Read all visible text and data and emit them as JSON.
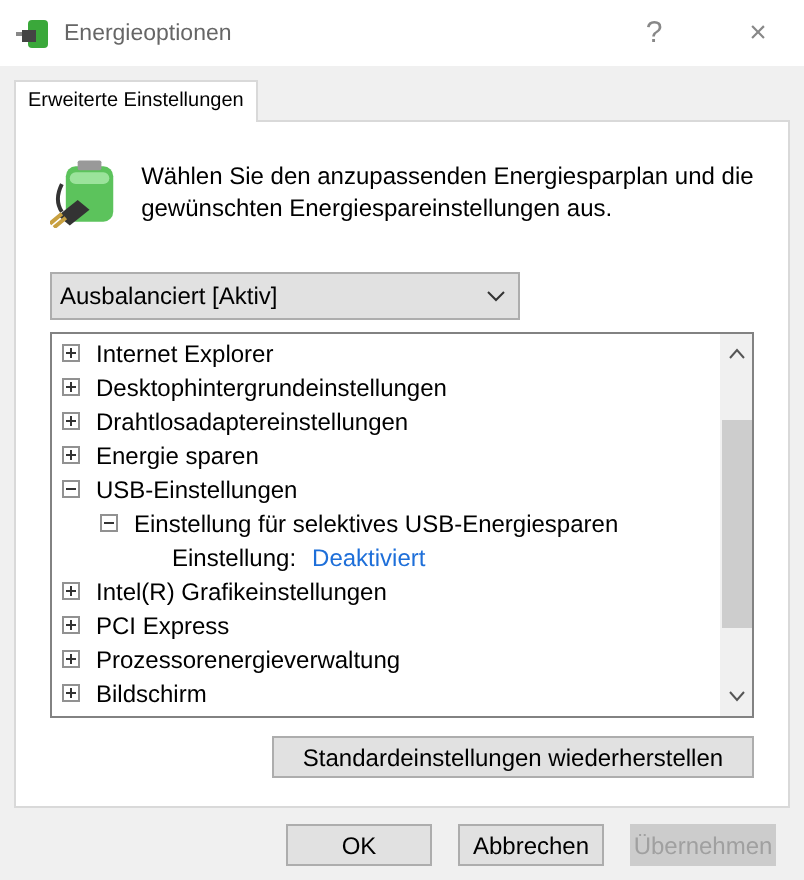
{
  "window": {
    "title": "Energieoptionen",
    "help": "?",
    "close": "×"
  },
  "tabs": [
    {
      "label": "Erweiterte Einstellungen",
      "selected": true
    }
  ],
  "description": "Wählen Sie den anzupassenden Energiesparplan und die gewünschten Energiespareinstellungen aus.",
  "plan_dropdown": {
    "value": "Ausbalanciert [Aktiv]"
  },
  "tree": [
    {
      "kind": "group",
      "label": "Internet Explorer",
      "expanded": false
    },
    {
      "kind": "group",
      "label": "Desktophintergrundeinstellungen",
      "expanded": false
    },
    {
      "kind": "group",
      "label": "Drahtlosadaptereinstellungen",
      "expanded": false
    },
    {
      "kind": "group",
      "label": "Energie sparen",
      "expanded": false
    },
    {
      "kind": "group",
      "label": "USB-Einstellungen",
      "expanded": true,
      "children": [
        {
          "kind": "group",
          "label": "Einstellung für selektives USB-Energiesparen",
          "expanded": true,
          "children": [
            {
              "kind": "setting",
              "label": "Einstellung:",
              "value": "Deaktiviert"
            }
          ]
        }
      ]
    },
    {
      "kind": "group",
      "label": "Intel(R) Grafikeinstellungen",
      "expanded": false
    },
    {
      "kind": "group",
      "label": "PCI Express",
      "expanded": false
    },
    {
      "kind": "group",
      "label": "Prozessorenergieverwaltung",
      "expanded": false
    },
    {
      "kind": "group",
      "label": "Bildschirm",
      "expanded": false
    }
  ],
  "restore_button": {
    "label": "Standardeinstellungen wiederherstellen"
  },
  "buttons": [
    {
      "label": "OK",
      "disabled": false
    },
    {
      "label": "Abbrechen",
      "disabled": false
    },
    {
      "label": "Übernehmen",
      "disabled": true
    }
  ]
}
